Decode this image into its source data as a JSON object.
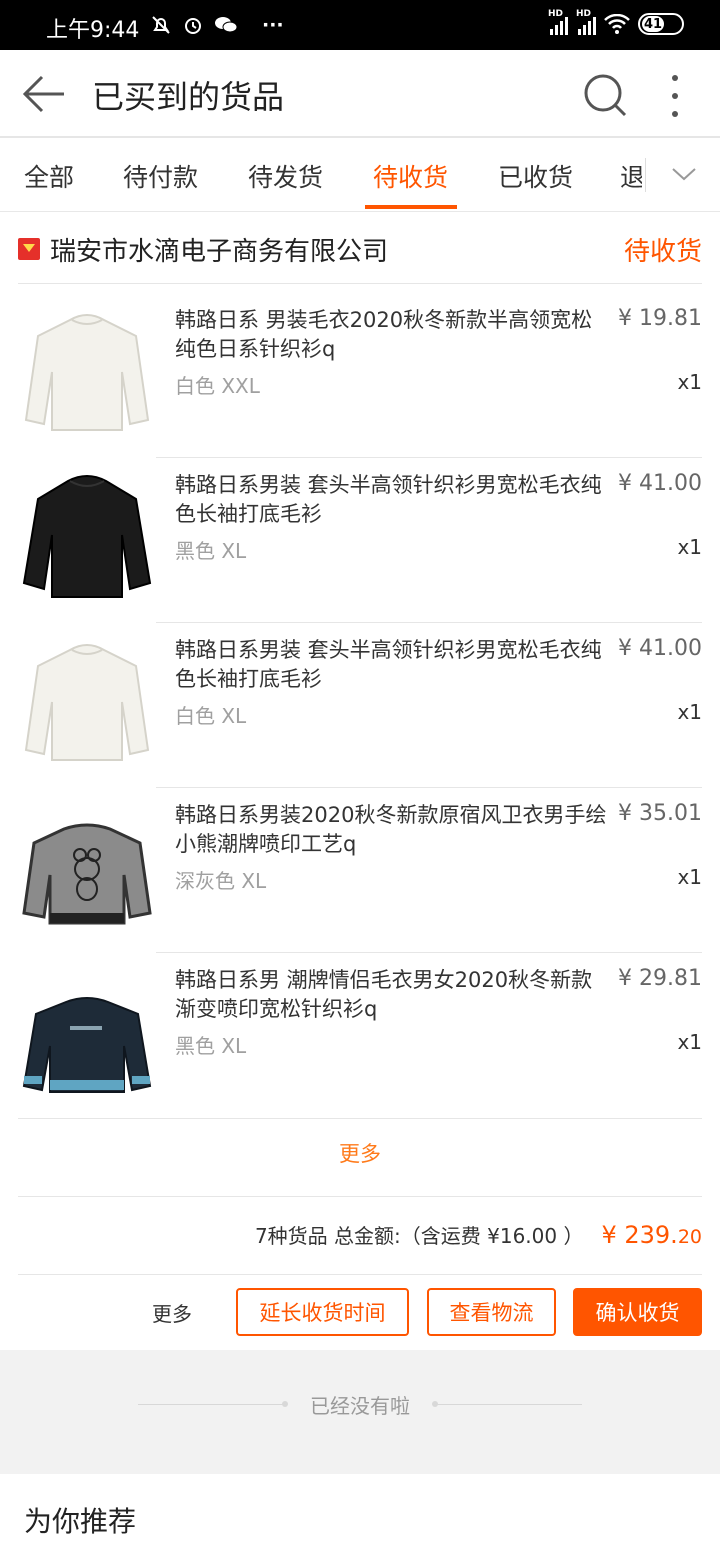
{
  "status_bar": {
    "time": "上午9:44",
    "battery": "41",
    "signal_label_1": "HD",
    "signal_label_2": "HD",
    "extra": "···"
  },
  "header": {
    "title": "已买到的货品"
  },
  "tabs": [
    "全部",
    "待付款",
    "待发货",
    "待收货",
    "已收货",
    "退"
  ],
  "active_tab": "待收货",
  "shop": {
    "name": "瑞安市水滴电子商务有限公司",
    "status": "待收货"
  },
  "items": [
    {
      "name": "韩路日系 男装毛衣2020秋冬新款半高领宽松纯色日系针织衫q",
      "sku": "白色 XXL",
      "price": "¥ 19.81",
      "qty": "x1",
      "thumb": "white-sweater"
    },
    {
      "name": "韩路日系男装 套头半高领针织衫男宽松毛衣纯色长袖打底毛衫",
      "sku": "黑色 XL",
      "price": "¥ 41.00",
      "qty": "x1",
      "thumb": "black-sweater"
    },
    {
      "name": "韩路日系男装 套头半高领针织衫男宽松毛衣纯色长袖打底毛衫",
      "sku": "白色 XL",
      "price": "¥ 41.00",
      "qty": "x1",
      "thumb": "white-sweater"
    },
    {
      "name": "韩路日系男装2020秋冬新款原宿风卫衣男手绘小熊潮牌喷印工艺q",
      "sku": "深灰色 XL",
      "price": "¥ 35.01",
      "qty": "x1",
      "thumb": "gray-bear-sweater"
    },
    {
      "name": "韩路日系男 潮牌情侣毛衣男女2020秋冬新款渐变喷印宽松针织衫q",
      "sku": "黑色 XL",
      "price": "¥ 29.81",
      "qty": "x1",
      "thumb": "navy-sweater"
    }
  ],
  "more_link": "更多",
  "summary": {
    "text": "7种货品 总金额:（含运费 ¥16.00 ）",
    "total_main": "¥ 239.",
    "total_cents": "20"
  },
  "actions": {
    "more": "更多",
    "extend": "延长收货时间",
    "logistics": "查看物流",
    "confirm": "确认收货"
  },
  "end_text": "已经没有啦",
  "recommend_title": "为你推荐",
  "colors": {
    "accent": "#ff5500",
    "secondary_text": "#a0a0a0"
  }
}
